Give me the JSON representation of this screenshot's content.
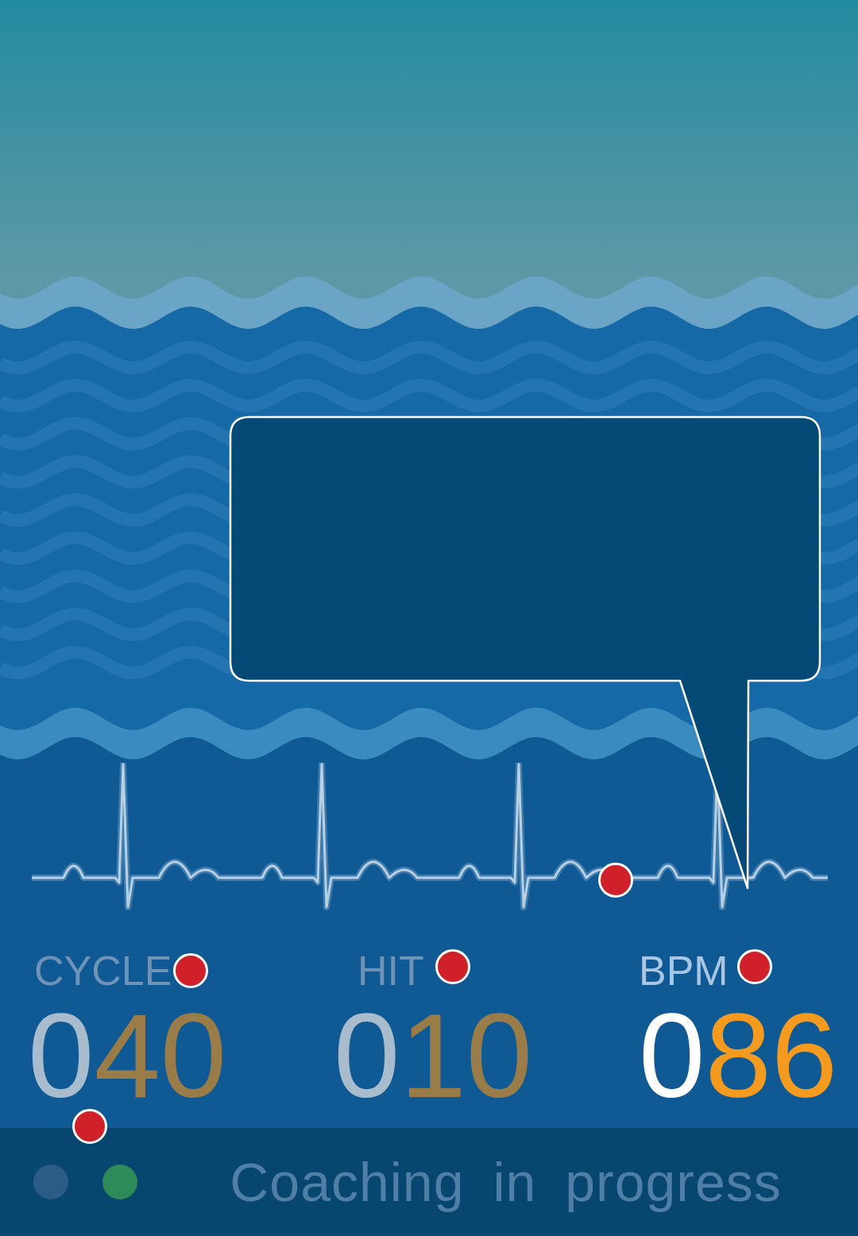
{
  "stats": [
    {
      "label": "CYCLE",
      "lead": "0",
      "value": "40",
      "active": false
    },
    {
      "label": "HIT",
      "lead": "0",
      "value": "10",
      "active": false
    },
    {
      "label": "BPM",
      "lead": "0",
      "value": "86",
      "active": true
    }
  ],
  "status_bar": {
    "indicators": [
      {
        "color": "#2a5c86"
      },
      {
        "color": "#2e8a58"
      }
    ],
    "text": "Coaching in progress"
  }
}
